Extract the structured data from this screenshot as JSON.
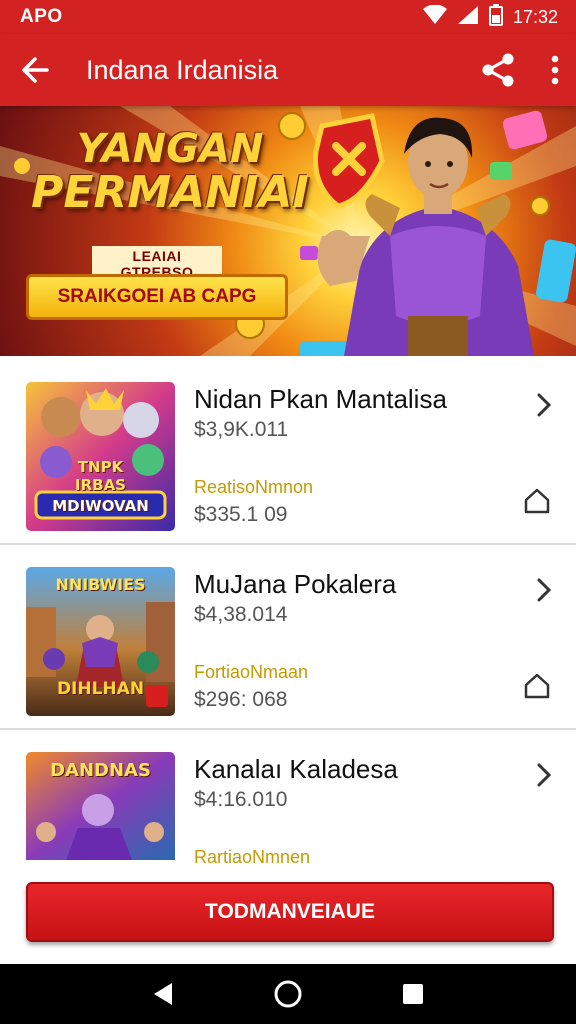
{
  "status_bar": {
    "left_text": "APO",
    "time": "17:32",
    "icons": [
      "wifi-icon",
      "signal-icon",
      "battery-icon"
    ]
  },
  "app_bar": {
    "title": "Indana Irdanisia",
    "icons": [
      "back-arrow-icon",
      "share-icon",
      "more-vert-icon"
    ]
  },
  "banner": {
    "title_line1": "YANGAN",
    "title_line2": "PERMANIAI",
    "subtitle": "LEAIAI GTREBSO",
    "cta_label": "SRAIKGOEI AB CAPG"
  },
  "items": [
    {
      "title": "Nidan Pkan Mantalisa",
      "price": "$3,9K.011",
      "subtitle": "ReatisoNmnon",
      "sub_price": "$335.1 09",
      "thumb_text_top": "TNPK",
      "thumb_text_mid": "IRBAS",
      "thumb_text_bottom": "MDIWOVAN"
    },
    {
      "title": "MuJana Pokalera",
      "price": "$4,38.014",
      "subtitle": "FortiaoNmaan",
      "sub_price": "$296: 068",
      "thumb_text_top": "NNIBWIES",
      "thumb_text_bottom": "DIHLHAN"
    },
    {
      "title": "Kanalaı Kaladesa",
      "price": "$4:16.010",
      "subtitle": "RartiaoNmnen",
      "sub_price": "",
      "thumb_text_top": "DANDNAS"
    }
  ],
  "primary_button": {
    "label": "TODMANVEIAUE"
  },
  "colors": {
    "primary": "#d32222",
    "accent_gold": "#c49a00",
    "nav_bg": "#000000"
  }
}
